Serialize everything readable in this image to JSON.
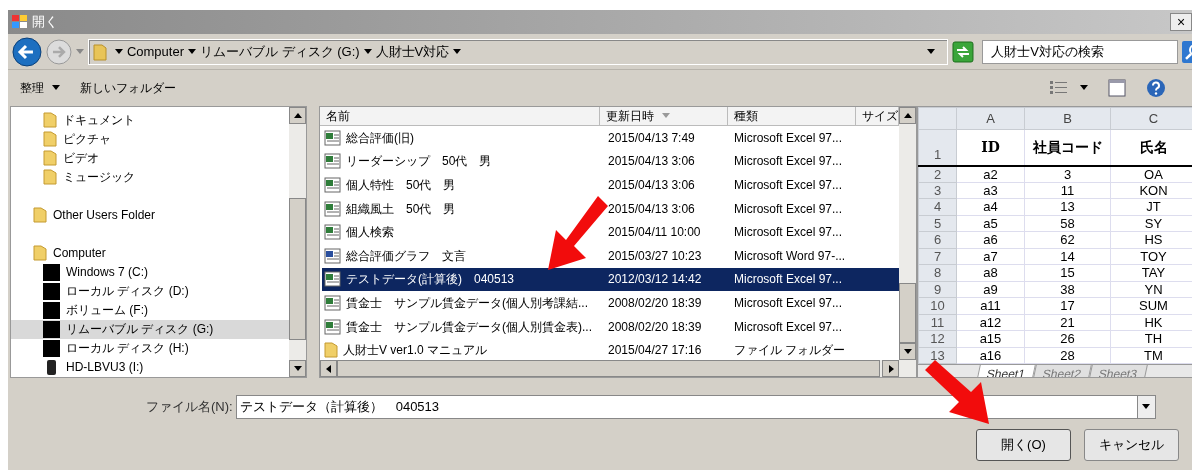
{
  "window": {
    "title": "開く",
    "close": "×"
  },
  "address_bar": {
    "crumbs": [
      "Computer",
      "リムーバブル ディスク (G:)",
      "人財士V対応"
    ],
    "search_placeholder": "人財士V対応の検索"
  },
  "toolbar": {
    "organize": "整理",
    "new_folder": "新しいフォルダー"
  },
  "sidebar": {
    "items": [
      {
        "kind": "subfolder",
        "label": "ドキュメント",
        "selected": false
      },
      {
        "kind": "subfolder",
        "label": "ピクチャ",
        "selected": false
      },
      {
        "kind": "subfolder",
        "label": "ビデオ",
        "selected": false
      },
      {
        "kind": "subfolder",
        "label": "ミュージック",
        "selected": false
      },
      {
        "kind": "folder",
        "label": "Other Users Folder",
        "selected": false
      },
      {
        "kind": "folder",
        "label": "Computer",
        "selected": false,
        "children": [
          {
            "kind": "drive",
            "label": "Windows 7 (C:)",
            "selected": false
          },
          {
            "kind": "drive",
            "label": "ローカル ディスク (D:)",
            "selected": false
          },
          {
            "kind": "drive",
            "label": "ボリューム (F:)",
            "selected": false
          },
          {
            "kind": "drive",
            "label": "リムーバブル ディスク (G:)",
            "selected": true
          },
          {
            "kind": "drive",
            "label": "ローカル ディスク (H:)",
            "selected": false
          },
          {
            "kind": "hdd",
            "label": "HD-LBVU3 (I:)",
            "selected": false
          }
        ]
      }
    ]
  },
  "file_list": {
    "columns": [
      "名前",
      "更新日時",
      "種類",
      "サイズ"
    ],
    "rows": [
      {
        "kind": "excel",
        "name": "総合評価(旧)",
        "date": "2015/04/13 7:49",
        "type": "Microsoft Excel 97...",
        "selected": false
      },
      {
        "kind": "excel",
        "name": "リーダーシップ　50代　男",
        "date": "2015/04/13 3:06",
        "type": "Microsoft Excel 97...",
        "selected": false
      },
      {
        "kind": "excel",
        "name": "個人特性　50代　男",
        "date": "2015/04/13 3:06",
        "type": "Microsoft Excel 97...",
        "selected": false
      },
      {
        "kind": "excel",
        "name": "組織風土　50代　男",
        "date": "2015/04/13 3:06",
        "type": "Microsoft Excel 97...",
        "selected": false
      },
      {
        "kind": "excel",
        "name": "個人検索",
        "date": "2015/04/11 10:00",
        "type": "Microsoft Excel 97...",
        "selected": false
      },
      {
        "kind": "word",
        "name": "総合評価グラフ　文言",
        "date": "2015/03/27 10:23",
        "type": "Microsoft Word 97-...",
        "selected": false
      },
      {
        "kind": "excel",
        "name": "テストデータ(計算後)　040513",
        "date": "2012/03/12 14:42",
        "type": "Microsoft Excel 97...",
        "selected": true
      },
      {
        "kind": "excel",
        "name": "賃金士　サンプル賃金データ(個人別考課結...",
        "date": "2008/02/20 18:39",
        "type": "Microsoft Excel 97...",
        "selected": false
      },
      {
        "kind": "excel",
        "name": "賃金士　サンプル賃金データ(個人別賃金表)...",
        "date": "2008/02/20 18:39",
        "type": "Microsoft Excel 97...",
        "selected": false
      },
      {
        "kind": "folder",
        "name": "人財士V ver1.0 マニュアル",
        "date": "2015/04/27 17:16",
        "type": "ファイル フォルダー",
        "selected": false
      }
    ]
  },
  "preview": {
    "columns": [
      "A",
      "B",
      "C"
    ],
    "header_row": {
      "number": "1",
      "cells": [
        "ID",
        "社員コード",
        "氏名"
      ]
    },
    "rows": [
      {
        "number": "2",
        "cells": [
          "a2",
          "3",
          "OA"
        ]
      },
      {
        "number": "3",
        "cells": [
          "a3",
          "11",
          "KON"
        ]
      },
      {
        "number": "4",
        "cells": [
          "a4",
          "13",
          "JT"
        ]
      },
      {
        "number": "5",
        "cells": [
          "a5",
          "58",
          "SY"
        ]
      },
      {
        "number": "6",
        "cells": [
          "a6",
          "62",
          "HS"
        ]
      },
      {
        "number": "7",
        "cells": [
          "a7",
          "14",
          "TOY"
        ]
      },
      {
        "number": "8",
        "cells": [
          "a8",
          "15",
          "TAY"
        ]
      },
      {
        "number": "9",
        "cells": [
          "a9",
          "38",
          "YN"
        ]
      },
      {
        "number": "10",
        "cells": [
          "a11",
          "17",
          "SUM"
        ]
      },
      {
        "number": "11",
        "cells": [
          "a12",
          "21",
          "HK"
        ]
      },
      {
        "number": "12",
        "cells": [
          "a15",
          "26",
          "TH"
        ]
      },
      {
        "number": "13",
        "cells": [
          "a16",
          "28",
          "TM"
        ]
      }
    ],
    "sheets": [
      {
        "label": "Sheet1",
        "selected": true
      },
      {
        "label": "Sheet2",
        "selected": false
      },
      {
        "label": "Sheet3",
        "selected": false
      }
    ]
  },
  "filename": {
    "label": "ファイル名(N):",
    "value": "テストデータ（計算後）　040513"
  },
  "buttons": [
    {
      "kind": "primary",
      "label": "開く(O)"
    },
    {
      "kind": "cancel",
      "label": "キャンセル"
    }
  ]
}
